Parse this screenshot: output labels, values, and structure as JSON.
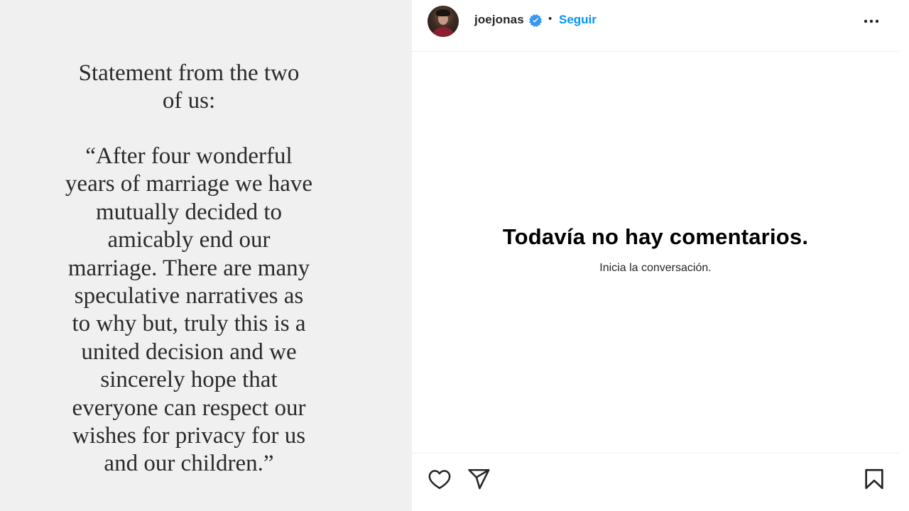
{
  "post": {
    "statement_title_lines": [
      "Statement from the two",
      "of us:"
    ],
    "statement_body_lines": [
      "“After four wonderful",
      "years of marriage we have",
      "mutually decided to",
      "amicably end our",
      "marriage. There are many",
      "speculative narratives as",
      "to why but, truly this is a",
      "united decision and we",
      "sincerely hope that",
      "everyone can respect our",
      "wishes for privacy for us",
      "and our children.”"
    ]
  },
  "header": {
    "username": "joejonas",
    "separator": "•",
    "follow_label": "Seguir",
    "avatar_icon": "profile-avatar",
    "verified_icon": "verified-badge-icon",
    "more_icon": "more-options-icon"
  },
  "comments": {
    "empty_title": "Todavía no hay comentarios.",
    "empty_subtitle": "Inicia la conversación."
  },
  "actions": {
    "like_icon": "heart-icon",
    "share_icon": "send-icon",
    "save_icon": "bookmark-icon"
  },
  "colors": {
    "follow": "#0095f6",
    "verified": "#3897f0",
    "image_bg": "#f0f0f0",
    "text": "#262626"
  }
}
